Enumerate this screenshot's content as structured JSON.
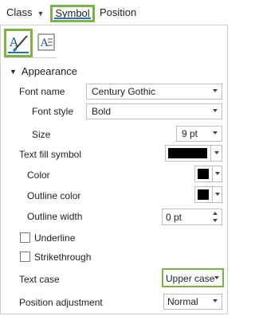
{
  "tabs": {
    "class": "Class",
    "symbol": "Symbol",
    "position": "Position"
  },
  "section": {
    "title": "Appearance"
  },
  "font_name": {
    "label": "Font name",
    "value": "Century Gothic"
  },
  "font_style": {
    "label": "Font style",
    "value": "Bold"
  },
  "size": {
    "label": "Size",
    "value": "9 pt"
  },
  "text_fill_symbol": {
    "label": "Text fill symbol",
    "color": "#000000"
  },
  "color": {
    "label": "Color",
    "value": "#000000"
  },
  "outline_color": {
    "label": "Outline color",
    "value": "#000000"
  },
  "outline_width": {
    "label": "Outline width",
    "value": "0 pt"
  },
  "underline": {
    "label": "Underline",
    "checked": false
  },
  "strikethrough": {
    "label": "Strikethrough",
    "checked": false
  },
  "text_case": {
    "label": "Text case",
    "value": "Upper case"
  },
  "position_adjustment": {
    "label": "Position adjustment",
    "value": "Normal"
  },
  "colors": {
    "highlight": "#7cb342",
    "accent": "#2b6cc4"
  }
}
